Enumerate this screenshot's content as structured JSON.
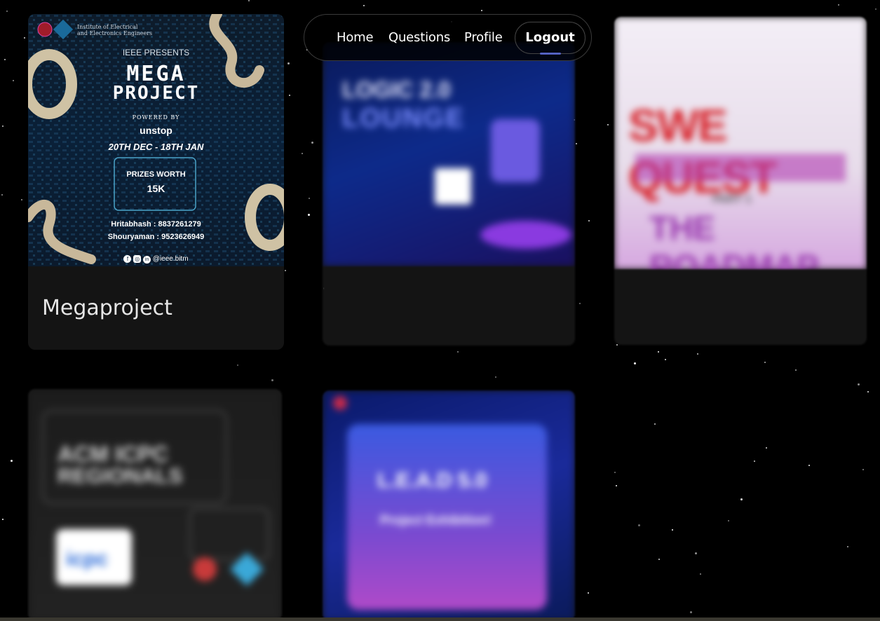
{
  "nav": {
    "items": [
      "Home",
      "Questions",
      "Profile"
    ],
    "logout_label": "Logout"
  },
  "cards": [
    {
      "title": "Megaproject",
      "poster": {
        "org": [
          "Institute of Electrical",
          "and Electronics Engineers"
        ],
        "presents": "IEEE PRESENTS",
        "headline": [
          "MEGA",
          "PROJECT"
        ],
        "powered_by": "POWERED BY",
        "sponsor": "unstop",
        "dates": "20TH DEC - 18TH JAN",
        "prize_label": "PRIZES WORTH",
        "prize_value": "15K",
        "contacts": [
          "Hritabhash : 8837261279",
          "Shouryaman : 9523626949"
        ],
        "handle": "@ieee.bitm"
      }
    },
    {
      "title": "",
      "poster": {
        "headline": [
          "LOGIC 2.0",
          "LOUNGE"
        ]
      }
    },
    {
      "title": "",
      "poster": {
        "headline": [
          "SWE QUEST",
          "THE ROADMAP"
        ],
        "part": "PART 1"
      }
    },
    {
      "title": "",
      "poster": {
        "headline": [
          "ACM ICPC",
          "REGIONALS"
        ],
        "logo": "icpc"
      }
    },
    {
      "title": "",
      "poster": {
        "headline": [
          "L.E.A.D 5.0",
          "Project Exhibition!"
        ]
      }
    }
  ],
  "colors": {
    "background": "#000000",
    "card": "#141414",
    "nav_border": "#3a3a3a",
    "accent": "#6a7cff"
  },
  "icons": [
    "facebook-icon",
    "instagram-icon",
    "linkedin-icon"
  ]
}
